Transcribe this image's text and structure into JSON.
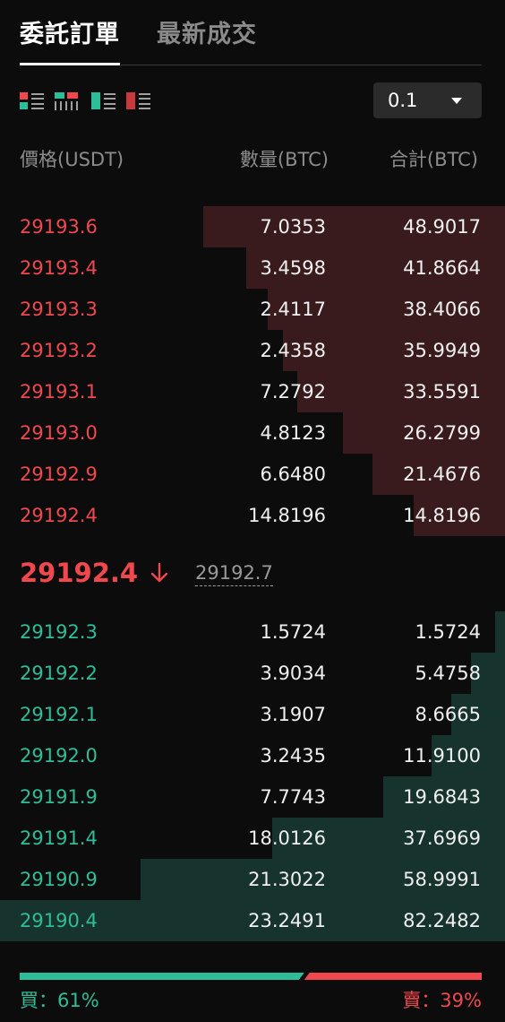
{
  "tabs": [
    {
      "label": "委託訂單",
      "active": true
    },
    {
      "label": "最新成交",
      "active": false
    }
  ],
  "toolbar": {
    "view_icons": [
      "both-sides-view-icon",
      "depth-bars-view-icon",
      "bids-only-view-icon",
      "asks-only-view-icon"
    ],
    "precision": "0.1"
  },
  "columns": {
    "price": "價格(USDT)",
    "quantity": "數量(BTC)",
    "total": "合計(BTC)"
  },
  "asks": [
    {
      "price": "29193.6",
      "qty": "7.0353",
      "total": "48.9017",
      "depth": 0.5983
    },
    {
      "price": "29193.4",
      "qty": "3.4598",
      "total": "41.8664",
      "depth": 0.5124
    },
    {
      "price": "29193.3",
      "qty": "2.4117",
      "total": "38.4066",
      "depth": 0.4701
    },
    {
      "price": "29193.2",
      "qty": "2.4358",
      "total": "35.9949",
      "depth": 0.4403
    },
    {
      "price": "29193.1",
      "qty": "7.2792",
      "total": "33.5591",
      "depth": 0.4107
    },
    {
      "price": "29193.0",
      "qty": "4.8123",
      "total": "26.2799",
      "depth": 0.3216
    },
    {
      "price": "29192.9",
      "qty": "6.6480",
      "total": "21.4676",
      "depth": 0.2627
    },
    {
      "price": "29192.4",
      "qty": "14.8196",
      "total": "14.8196",
      "depth": 0.1813
    }
  ],
  "mid": {
    "last_price": "29192.4",
    "direction": "down",
    "mark_price": "29192.7"
  },
  "bids": [
    {
      "price": "29192.3",
      "qty": "1.5724",
      "total": "1.5724",
      "depth": 0.0192
    },
    {
      "price": "29192.2",
      "qty": "3.9034",
      "total": "5.4758",
      "depth": 0.067
    },
    {
      "price": "29192.1",
      "qty": "3.1907",
      "total": "8.6665",
      "depth": 0.106
    },
    {
      "price": "29192.0",
      "qty": "3.2435",
      "total": "11.9100",
      "depth": 0.1457
    },
    {
      "price": "29191.9",
      "qty": "7.7743",
      "total": "19.6843",
      "depth": 0.2408
    },
    {
      "price": "29191.4",
      "qty": "18.0126",
      "total": "37.6969",
      "depth": 0.4612
    },
    {
      "price": "29190.9",
      "qty": "21.3022",
      "total": "58.9991",
      "depth": 0.7218
    },
    {
      "price": "29190.4",
      "qty": "23.2491",
      "total": "82.2482",
      "depth": 1.0
    }
  ],
  "ratio": {
    "buy_label": "買：61%",
    "sell_label": "賣：39%",
    "buy_fraction": 0.61
  },
  "colors": {
    "ask": "#f0484d",
    "bid": "#2ebd99",
    "ask_depth": "#3a1b1d",
    "bid_depth": "#17332d"
  }
}
